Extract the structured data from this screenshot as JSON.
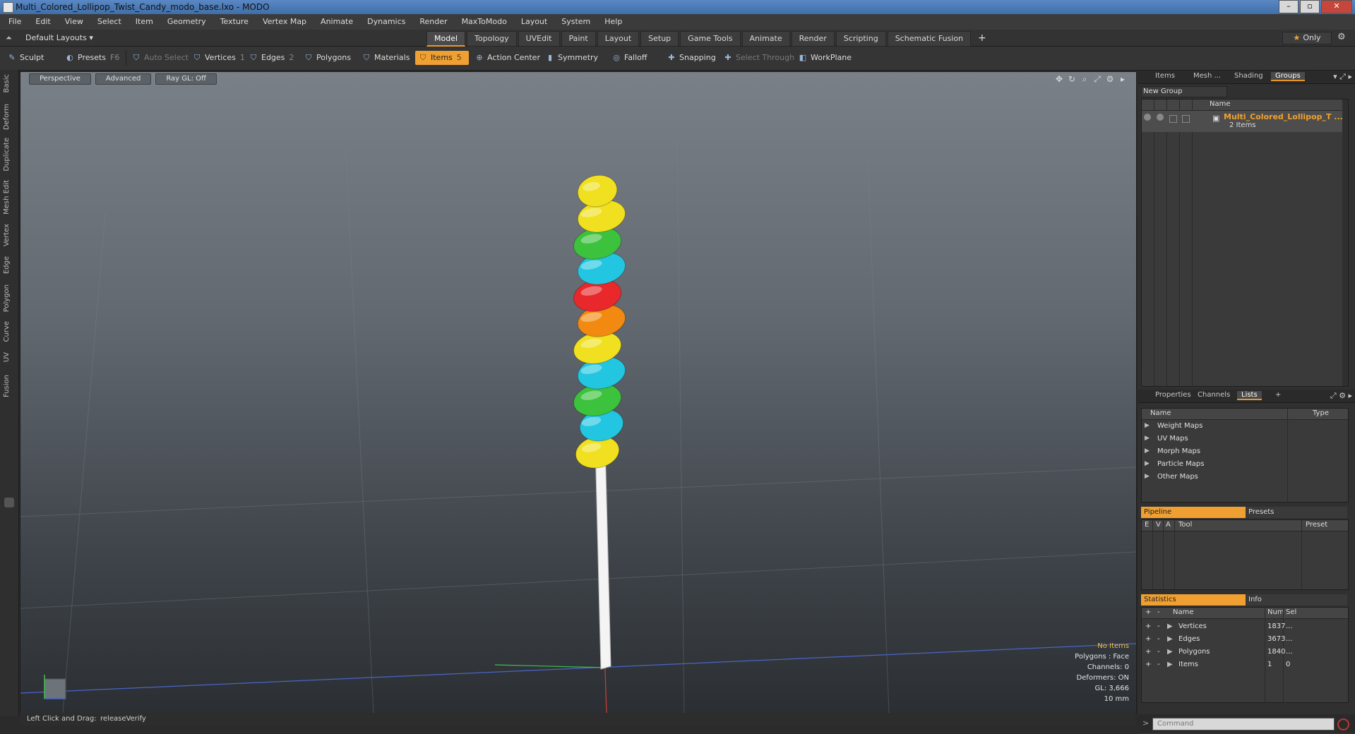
{
  "window": {
    "title": "Multi_Colored_Lollipop_Twist_Candy_modo_base.lxo - MODO"
  },
  "menu": [
    "File",
    "Edit",
    "View",
    "Select",
    "Item",
    "Geometry",
    "Texture",
    "Vertex Map",
    "Animate",
    "Dynamics",
    "Render",
    "MaxToModo",
    "Layout",
    "System",
    "Help"
  ],
  "layout": {
    "selector": "Default Layouts",
    "tabs": [
      "Model",
      "Topology",
      "UVEdit",
      "Paint",
      "Layout",
      "Setup",
      "Game Tools",
      "Animate",
      "Render",
      "Scripting",
      "Schematic Fusion"
    ],
    "active_tab": "Model",
    "plus": "+",
    "only_label": "Only"
  },
  "toolbar": {
    "sculpt": "Sculpt",
    "presets": "Presets",
    "presets_key": "F6",
    "auto_select": "Auto Select",
    "vertices": "Vertices",
    "vertices_count": "1",
    "edges": "Edges",
    "edges_count": "2",
    "polygons": "Polygons",
    "materials": "Materials",
    "items": "Items",
    "items_count": "5",
    "action_center": "Action Center",
    "symmetry": "Symmetry",
    "falloff": "Falloff",
    "snapping": "Snapping",
    "select_through": "Select Through",
    "workplane": "WorkPlane"
  },
  "left_tabs": [
    "Basic",
    "Deform",
    "Duplicate",
    "Mesh Edit",
    "Vertex",
    "Edge",
    "Polygon",
    "Curve",
    "UV",
    "Fusion"
  ],
  "viewport": {
    "view": "Perspective",
    "mode": "Advanced",
    "raygl": "Ray GL: Off",
    "info": {
      "items": "No Items",
      "polygons": "Polygons : Face",
      "channels": "Channels: 0",
      "deformers": "Deformers: ON",
      "gl": "GL: 3,666",
      "scale": "10 mm"
    },
    "candy_colors": [
      "#f0e020",
      "#3cc23c",
      "#23c6e0",
      "#e8282a",
      "#f28a12",
      "#ffffff"
    ]
  },
  "status": {
    "hint_label": "Left Click and Drag:",
    "hint_value": "releaseVerify"
  },
  "groups_panel": {
    "tabs": [
      "Items",
      "Mesh ...",
      "Shading",
      "Groups"
    ],
    "active_tab": "Groups",
    "new_group": "New Group",
    "col_name": "Name",
    "group_name": "Multi_Colored_Lollipop_T ...",
    "group_sub": "2 Items"
  },
  "lists_panel": {
    "tabs": [
      "Properties",
      "Channels",
      "Lists"
    ],
    "active_tab": "Lists",
    "plus": "+",
    "col_name": "Name",
    "col_type": "Type",
    "items": [
      "Weight Maps",
      "UV Maps",
      "Morph Maps",
      "Particle Maps",
      "Other Maps"
    ]
  },
  "pipeline_panel": {
    "tabs": [
      "Pipeline",
      "Presets"
    ],
    "cols": [
      "E",
      "V",
      "A",
      "Tool",
      "Preset"
    ]
  },
  "stats_panel": {
    "tabs": [
      "Statistics",
      "Info"
    ],
    "cols": {
      "plus": "+",
      "minus": "-",
      "name": "Name",
      "num": "Num",
      "sel": "Sel"
    },
    "rows": [
      {
        "name": "Vertices",
        "num": "1837",
        "sel": "..."
      },
      {
        "name": "Edges",
        "num": "3673",
        "sel": "..."
      },
      {
        "name": "Polygons",
        "num": "1840",
        "sel": "..."
      },
      {
        "name": "Items",
        "num": "1",
        "sel": "0"
      }
    ]
  },
  "command": {
    "placeholder": "Command"
  }
}
